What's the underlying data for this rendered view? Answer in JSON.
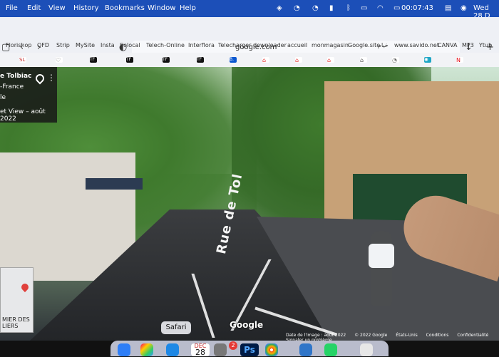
{
  "menu": {
    "items": [
      "File",
      "Edit",
      "View",
      "History",
      "Bookmarks",
      "Window",
      "Help"
    ],
    "clock": "00:07:43",
    "date": "Wed 28 D"
  },
  "browser": {
    "url": "google.com",
    "bookmarks": [
      "Florishop",
      "QFD",
      "Strip",
      "MySite",
      "Insta",
      "Solocal",
      "Telech-Online",
      "Interflora",
      "Telecharger",
      "downloader",
      "accueil",
      "monmagasin",
      "Google.site",
      "خيام",
      "www.savido.net",
      "CANVA",
      "MP3",
      "Ytub"
    ],
    "favicons": [
      "SL",
      "♡",
      "TF",
      "TF",
      "TF",
      "TF",
      "B.",
      "⌂",
      "⌂",
      "⌂",
      "⌂",
      "◔",
      "✺",
      "N"
    ]
  },
  "streetview": {
    "place_title": "e Tolbiac",
    "place_region": "-France",
    "place_city": "le",
    "capture": "et View – août 2022",
    "road_text": "Rue de Tol",
    "minimap_label": "MIER DES\nLIERS",
    "google_logo": "Google",
    "credits": [
      "Date de l'image : août 2022",
      "© 2022 Google",
      "États-Unis",
      "Conditions",
      "Confidentialité",
      "Signaler un problème"
    ]
  },
  "dock": {
    "tooltip": "Safari",
    "badge": "2",
    "calendar_month": "DEC",
    "calendar_day": "28",
    "ps_label": "Ps"
  },
  "colors": {
    "menubar": "#1c4fb8",
    "toolbar": "#eef0f5",
    "dock": "#b9bccc",
    "map_pin": "#e0403c"
  }
}
